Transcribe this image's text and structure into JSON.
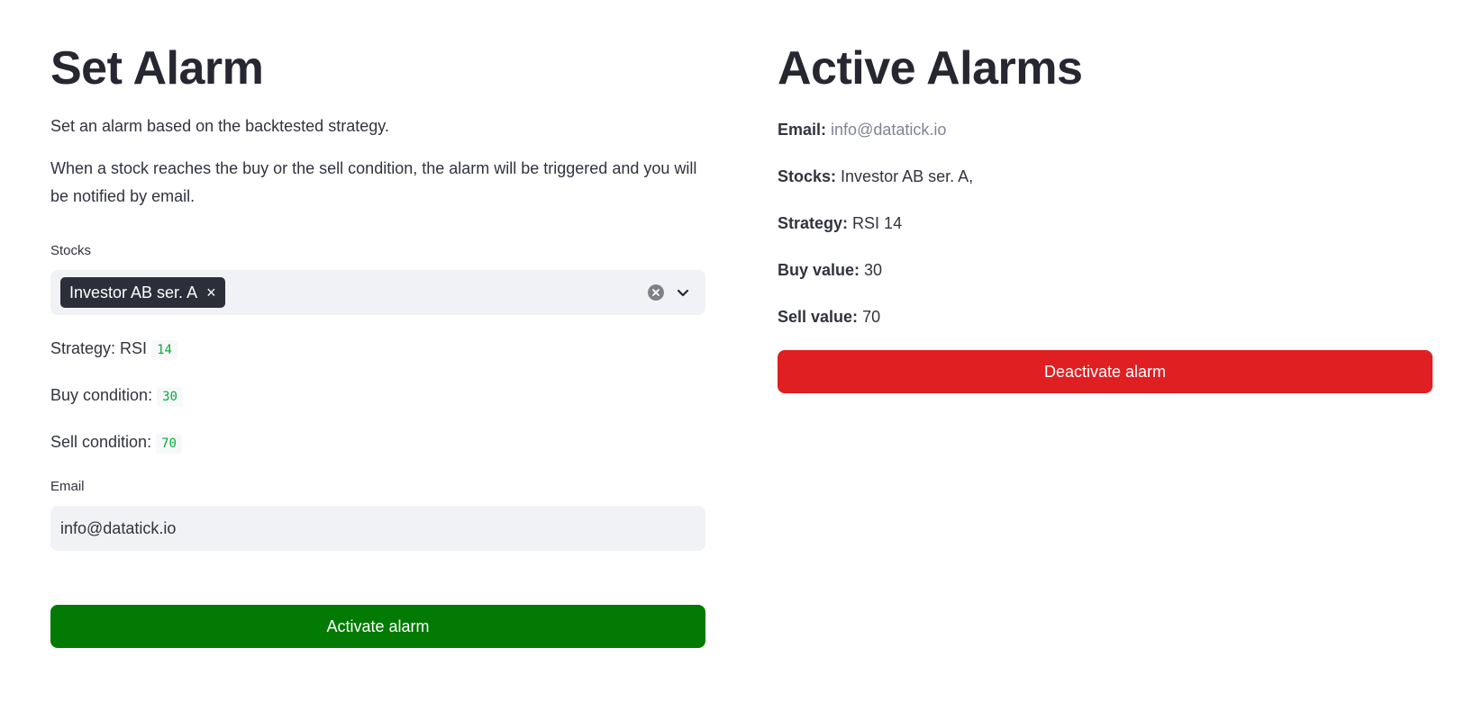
{
  "set_alarm": {
    "title": "Set Alarm",
    "intro": "Set an alarm based on the backtested strategy.",
    "description": "When a stock reaches the buy or the sell condition, the alarm will be triggered and you will be notified by email.",
    "stocks_label": "Stocks",
    "selected_stock": "Investor AB ser. A",
    "strategy_label": "Strategy: RSI",
    "strategy_value": "14",
    "buy_label": "Buy condition:",
    "buy_value": "30",
    "sell_label": "Sell condition:",
    "sell_value": "70",
    "email_label": "Email",
    "email_value": "info@datatick.io",
    "activate_button": "Activate alarm"
  },
  "active_alarms": {
    "title": "Active Alarms",
    "email_label": "Email:",
    "email_value": "info@datatick.io",
    "stocks_label": "Stocks:",
    "stocks_value": "Investor AB ser. A,",
    "strategy_label": "Strategy:",
    "strategy_value": "RSI 14",
    "buy_label": "Buy value:",
    "buy_value": "30",
    "sell_label": "Sell value:",
    "sell_value": "70",
    "deactivate_button": "Deactivate alarm"
  },
  "icons": {
    "tag_remove": "close-icon",
    "clear": "clear-circle-icon",
    "dropdown": "chevron-down-icon"
  },
  "colors": {
    "activate": "#037a03",
    "deactivate": "#df1f22",
    "code": "#09ab3b"
  }
}
